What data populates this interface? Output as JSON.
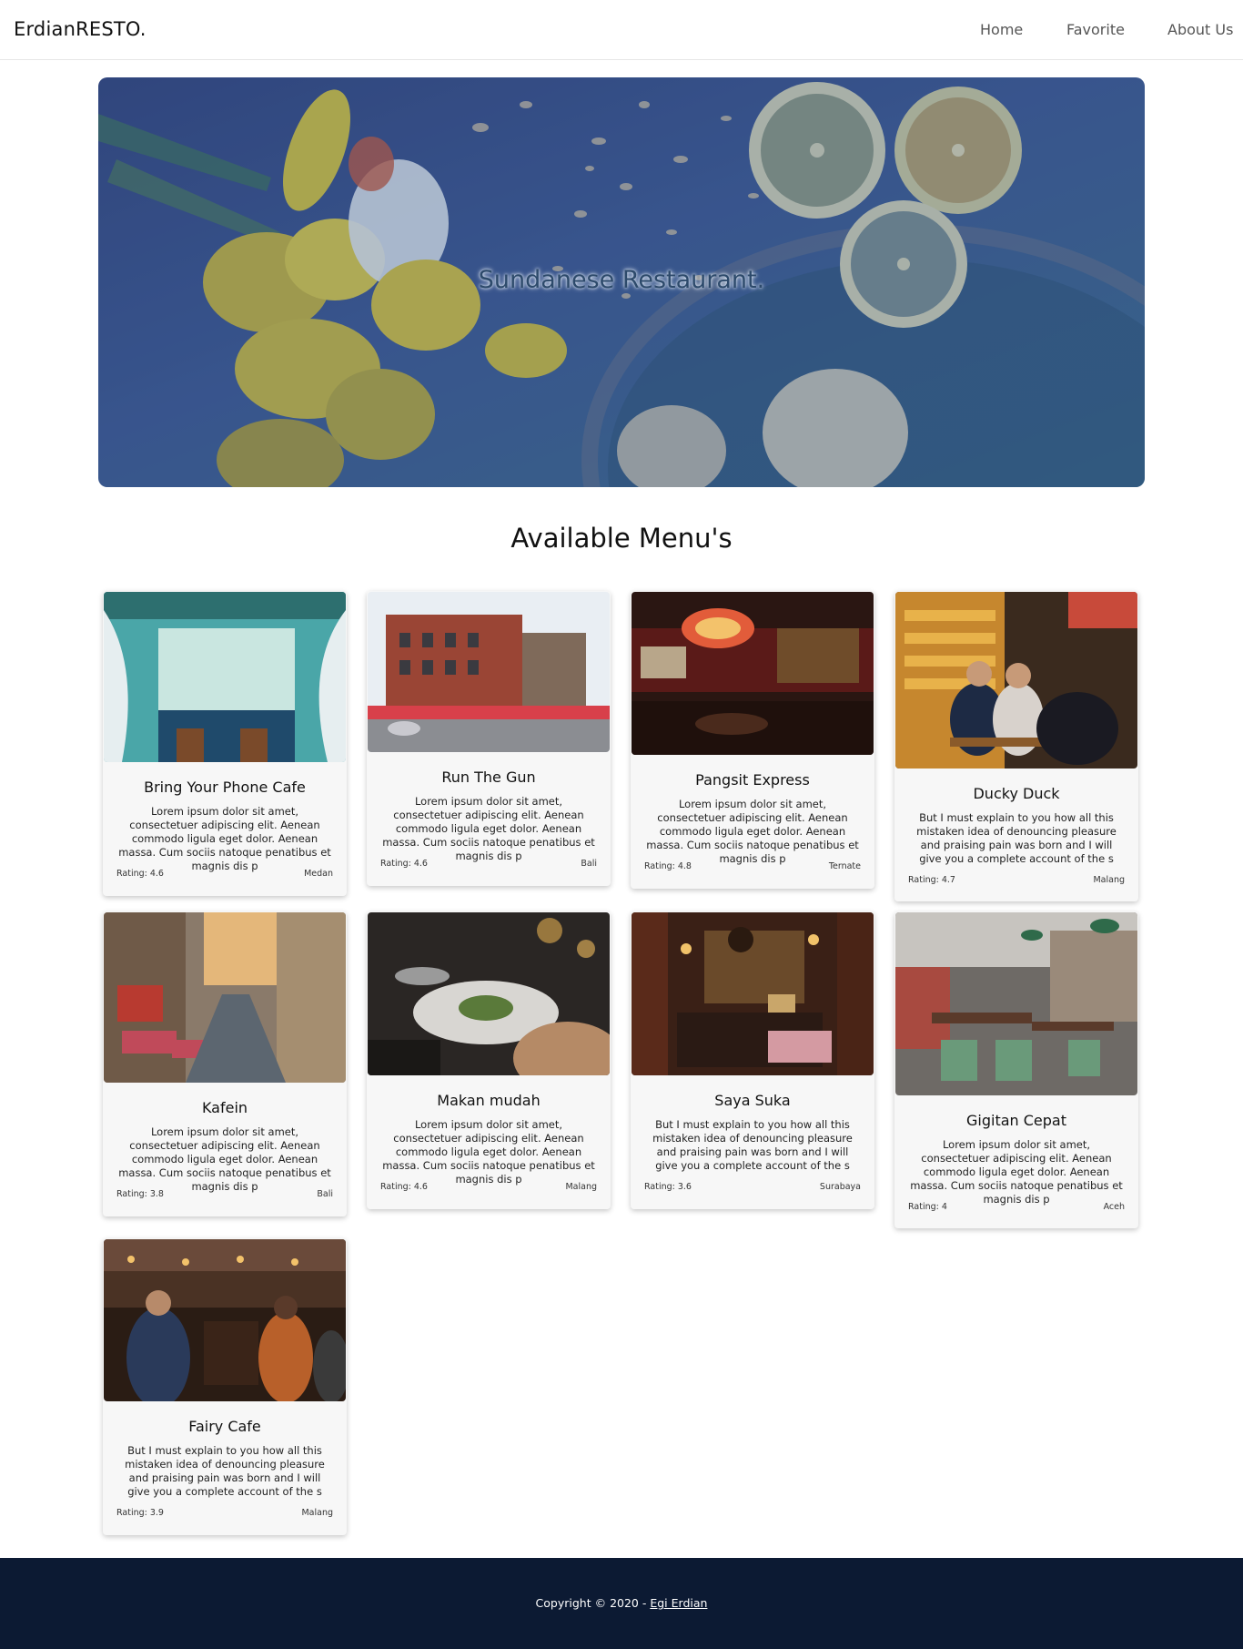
{
  "nav": {
    "brand": "ErdianRESTO.",
    "links": [
      "Home",
      "Favorite",
      "About Us"
    ]
  },
  "hero": {
    "title": "Sundanese Restaurant."
  },
  "section": {
    "title": "Available Menu's"
  },
  "restaurants": [
    {
      "name": "Bring Your Phone Cafe",
      "desc": "Lorem ipsum dolor sit amet, consectetuer adipiscing elit. Aenean commodo ligula eget dolor. Aenean massa. Cum sociis natoque penatibus et magnis dis p",
      "rating": "Rating: 4.6",
      "city": "Medan"
    },
    {
      "name": "Run The Gun",
      "desc": "Lorem ipsum dolor sit amet, consectetuer adipiscing elit. Aenean commodo ligula eget dolor. Aenean massa. Cum sociis natoque penatibus et magnis dis p",
      "rating": "Rating: 4.6",
      "city": "Bali"
    },
    {
      "name": "Pangsit Express",
      "desc": "Lorem ipsum dolor sit amet, consectetuer adipiscing elit. Aenean commodo ligula eget dolor. Aenean massa. Cum sociis natoque penatibus et magnis dis p",
      "rating": "Rating: 4.8",
      "city": "Ternate"
    },
    {
      "name": "Ducky Duck",
      "desc": "But I must explain to you how all this mistaken idea of denouncing pleasure and praising pain was born and I will give you a complete account of the s",
      "rating": "Rating: 4.7",
      "city": "Malang"
    },
    {
      "name": "Kafein",
      "desc": "Lorem ipsum dolor sit amet, consectetuer adipiscing elit. Aenean commodo ligula eget dolor. Aenean massa. Cum sociis natoque penatibus et magnis dis p",
      "rating": "Rating: 3.8",
      "city": "Bali"
    },
    {
      "name": "Makan mudah",
      "desc": "Lorem ipsum dolor sit amet, consectetuer adipiscing elit. Aenean commodo ligula eget dolor. Aenean massa. Cum sociis natoque penatibus et magnis dis p",
      "rating": "Rating: 4.6",
      "city": "Malang"
    },
    {
      "name": "Saya Suka",
      "desc": "But I must explain to you how all this mistaken idea of denouncing pleasure and praising pain was born and I will give you a complete account of the s",
      "rating": "Rating: 3.6",
      "city": "Surabaya"
    },
    {
      "name": "Gigitan Cepat",
      "desc": "Lorem ipsum dolor sit amet, consectetuer adipiscing elit. Aenean commodo ligula eget dolor. Aenean massa. Cum sociis natoque penatibus et magnis dis p",
      "rating": "Rating: 4",
      "city": "Aceh"
    },
    {
      "name": "Fairy Cafe",
      "desc": "But I must explain to you how all this mistaken idea of denouncing pleasure and praising pain was born and I will give you a complete account of the s",
      "rating": "Rating: 3.9",
      "city": "Malang"
    }
  ],
  "footer": {
    "text": "Copyright © 2020 - ",
    "link": "Egi Erdian"
  },
  "colors": {
    "footer_bg": "#0c1a33",
    "card_bg": "#f7f7f7",
    "hero_overlay": "#3c5790"
  }
}
